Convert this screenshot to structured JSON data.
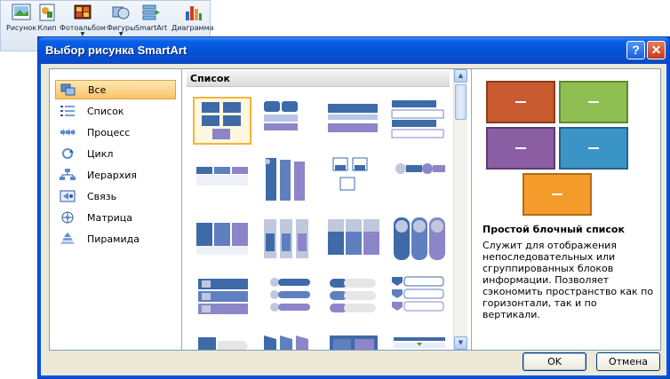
{
  "ribbon": {
    "buttons": [
      {
        "label": "Рисунок",
        "icon": "picture-icon"
      },
      {
        "label": "Клип",
        "icon": "clipart-icon"
      },
      {
        "label": "Фотоальбом",
        "icon": "photo-album-icon"
      },
      {
        "label": "Фигуры",
        "icon": "shapes-icon"
      },
      {
        "label": "SmartArt",
        "icon": "smartart-icon"
      },
      {
        "label": "Диаграмма",
        "icon": "chart-icon"
      }
    ]
  },
  "dialog": {
    "title": "Выбор рисунка SmartArt",
    "help_label": "?",
    "close_label": "✕",
    "categories": [
      {
        "label": "Все",
        "icon": "all-icon"
      },
      {
        "label": "Список",
        "icon": "list-icon"
      },
      {
        "label": "Процесс",
        "icon": "process-icon"
      },
      {
        "label": "Цикл",
        "icon": "cycle-icon"
      },
      {
        "label": "Иерархия",
        "icon": "hierarchy-icon"
      },
      {
        "label": "Связь",
        "icon": "relationship-icon"
      },
      {
        "label": "Матрица",
        "icon": "matrix-icon"
      },
      {
        "label": "Пирамида",
        "icon": "pyramid-icon"
      }
    ],
    "gallery_header": "Список",
    "preview": {
      "title": "Простой блочный список",
      "description": "Служит для отображения непоследовательных или сгруппированных блоков информации. Позволяет сэкономить пространство как по горизонтали, так и по вертикали.",
      "colors": [
        "#c9592f",
        "#8fbe52",
        "#8b5ea3",
        "#3b94c6",
        "#f59b2c"
      ]
    },
    "ok_label": "OK",
    "cancel_label": "Отмена",
    "colors": {
      "title_bar": "#0a5fe8",
      "selected_category": "#f8c365",
      "accent_blue": "#3e6aa8",
      "accent_purple": "#8c85c9"
    }
  }
}
